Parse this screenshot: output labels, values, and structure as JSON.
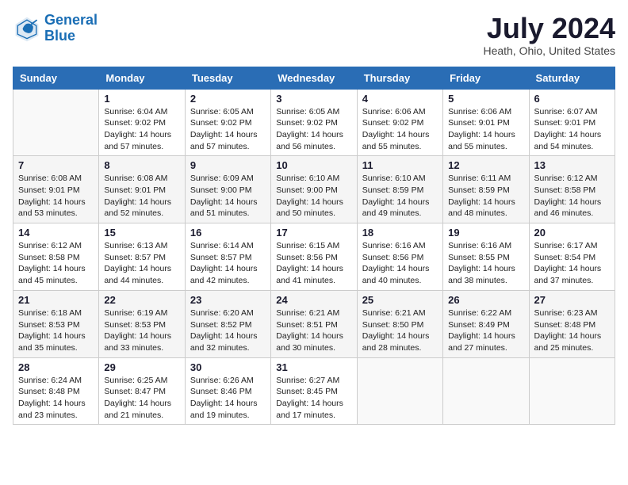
{
  "logo": {
    "line1": "General",
    "line2": "Blue"
  },
  "title": "July 2024",
  "location": "Heath, Ohio, United States",
  "header_days": [
    "Sunday",
    "Monday",
    "Tuesday",
    "Wednesday",
    "Thursday",
    "Friday",
    "Saturday"
  ],
  "weeks": [
    [
      {
        "day": "",
        "info": ""
      },
      {
        "day": "1",
        "info": "Sunrise: 6:04 AM\nSunset: 9:02 PM\nDaylight: 14 hours\nand 57 minutes."
      },
      {
        "day": "2",
        "info": "Sunrise: 6:05 AM\nSunset: 9:02 PM\nDaylight: 14 hours\nand 57 minutes."
      },
      {
        "day": "3",
        "info": "Sunrise: 6:05 AM\nSunset: 9:02 PM\nDaylight: 14 hours\nand 56 minutes."
      },
      {
        "day": "4",
        "info": "Sunrise: 6:06 AM\nSunset: 9:02 PM\nDaylight: 14 hours\nand 55 minutes."
      },
      {
        "day": "5",
        "info": "Sunrise: 6:06 AM\nSunset: 9:01 PM\nDaylight: 14 hours\nand 55 minutes."
      },
      {
        "day": "6",
        "info": "Sunrise: 6:07 AM\nSunset: 9:01 PM\nDaylight: 14 hours\nand 54 minutes."
      }
    ],
    [
      {
        "day": "7",
        "info": "Sunrise: 6:08 AM\nSunset: 9:01 PM\nDaylight: 14 hours\nand 53 minutes."
      },
      {
        "day": "8",
        "info": "Sunrise: 6:08 AM\nSunset: 9:01 PM\nDaylight: 14 hours\nand 52 minutes."
      },
      {
        "day": "9",
        "info": "Sunrise: 6:09 AM\nSunset: 9:00 PM\nDaylight: 14 hours\nand 51 minutes."
      },
      {
        "day": "10",
        "info": "Sunrise: 6:10 AM\nSunset: 9:00 PM\nDaylight: 14 hours\nand 50 minutes."
      },
      {
        "day": "11",
        "info": "Sunrise: 6:10 AM\nSunset: 8:59 PM\nDaylight: 14 hours\nand 49 minutes."
      },
      {
        "day": "12",
        "info": "Sunrise: 6:11 AM\nSunset: 8:59 PM\nDaylight: 14 hours\nand 48 minutes."
      },
      {
        "day": "13",
        "info": "Sunrise: 6:12 AM\nSunset: 8:58 PM\nDaylight: 14 hours\nand 46 minutes."
      }
    ],
    [
      {
        "day": "14",
        "info": "Sunrise: 6:12 AM\nSunset: 8:58 PM\nDaylight: 14 hours\nand 45 minutes."
      },
      {
        "day": "15",
        "info": "Sunrise: 6:13 AM\nSunset: 8:57 PM\nDaylight: 14 hours\nand 44 minutes."
      },
      {
        "day": "16",
        "info": "Sunrise: 6:14 AM\nSunset: 8:57 PM\nDaylight: 14 hours\nand 42 minutes."
      },
      {
        "day": "17",
        "info": "Sunrise: 6:15 AM\nSunset: 8:56 PM\nDaylight: 14 hours\nand 41 minutes."
      },
      {
        "day": "18",
        "info": "Sunrise: 6:16 AM\nSunset: 8:56 PM\nDaylight: 14 hours\nand 40 minutes."
      },
      {
        "day": "19",
        "info": "Sunrise: 6:16 AM\nSunset: 8:55 PM\nDaylight: 14 hours\nand 38 minutes."
      },
      {
        "day": "20",
        "info": "Sunrise: 6:17 AM\nSunset: 8:54 PM\nDaylight: 14 hours\nand 37 minutes."
      }
    ],
    [
      {
        "day": "21",
        "info": "Sunrise: 6:18 AM\nSunset: 8:53 PM\nDaylight: 14 hours\nand 35 minutes."
      },
      {
        "day": "22",
        "info": "Sunrise: 6:19 AM\nSunset: 8:53 PM\nDaylight: 14 hours\nand 33 minutes."
      },
      {
        "day": "23",
        "info": "Sunrise: 6:20 AM\nSunset: 8:52 PM\nDaylight: 14 hours\nand 32 minutes."
      },
      {
        "day": "24",
        "info": "Sunrise: 6:21 AM\nSunset: 8:51 PM\nDaylight: 14 hours\nand 30 minutes."
      },
      {
        "day": "25",
        "info": "Sunrise: 6:21 AM\nSunset: 8:50 PM\nDaylight: 14 hours\nand 28 minutes."
      },
      {
        "day": "26",
        "info": "Sunrise: 6:22 AM\nSunset: 8:49 PM\nDaylight: 14 hours\nand 27 minutes."
      },
      {
        "day": "27",
        "info": "Sunrise: 6:23 AM\nSunset: 8:48 PM\nDaylight: 14 hours\nand 25 minutes."
      }
    ],
    [
      {
        "day": "28",
        "info": "Sunrise: 6:24 AM\nSunset: 8:48 PM\nDaylight: 14 hours\nand 23 minutes."
      },
      {
        "day": "29",
        "info": "Sunrise: 6:25 AM\nSunset: 8:47 PM\nDaylight: 14 hours\nand 21 minutes."
      },
      {
        "day": "30",
        "info": "Sunrise: 6:26 AM\nSunset: 8:46 PM\nDaylight: 14 hours\nand 19 minutes."
      },
      {
        "day": "31",
        "info": "Sunrise: 6:27 AM\nSunset: 8:45 PM\nDaylight: 14 hours\nand 17 minutes."
      },
      {
        "day": "",
        "info": ""
      },
      {
        "day": "",
        "info": ""
      },
      {
        "day": "",
        "info": ""
      }
    ]
  ]
}
